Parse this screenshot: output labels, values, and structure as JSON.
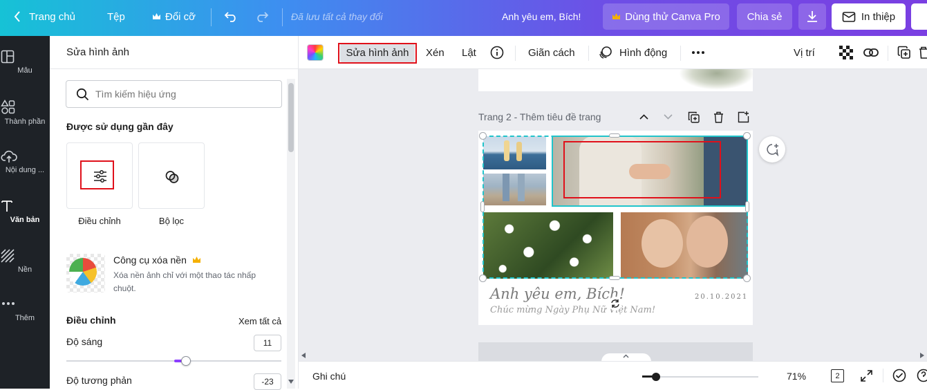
{
  "topbar": {
    "home": "Trang chủ",
    "file": "Tệp",
    "resize": "Đổi cỡ",
    "saved_status": "Đã lưu tất cả thay đổi",
    "design_title": "Anh yêu em, Bích!",
    "try_pro": "Dùng thử Canva Pro",
    "share": "Chia sẻ",
    "print": "In thiệp"
  },
  "rail": {
    "items": [
      {
        "label": "Mẫu",
        "icon": "layout-icon"
      },
      {
        "label": "Thành phần",
        "icon": "shapes-icon"
      },
      {
        "label": "Nội dung ...",
        "icon": "upload-cloud-icon"
      },
      {
        "label": "Văn bản",
        "icon": "text-icon"
      },
      {
        "label": "Nền",
        "icon": "background-pattern-icon"
      },
      {
        "label": "Thêm",
        "icon": "more-dots-icon"
      }
    ]
  },
  "panel": {
    "title": "Sửa hình ảnh",
    "search_placeholder": "Tìm kiếm hiệu ứng",
    "recent_heading": "Được sử dụng gần đây",
    "recent": [
      {
        "label": "Điều chỉnh"
      },
      {
        "label": "Bộ lọc"
      }
    ],
    "bg_remover": {
      "title": "Công cụ xóa nền",
      "desc": "Xóa nền ảnh chỉ với một thao tác nhấp chuột."
    },
    "adjust": {
      "heading": "Điều chỉnh",
      "see_all": "Xem tất cả",
      "sliders": [
        {
          "label": "Độ sáng",
          "value": "11",
          "fraction": 0.555
        },
        {
          "label": "Độ tương phản",
          "value": "-23",
          "fraction": 0.385
        }
      ]
    }
  },
  "toolbar": {
    "edit_image": "Sửa hình ảnh",
    "crop": "Xén",
    "flip": "Lật",
    "spacing": "Giãn cách",
    "animate": "Hình động",
    "position": "Vị trí"
  },
  "page2": {
    "label": "Trang 2 - Thêm tiêu đề trang",
    "card_title": "Anh yêu em, Bích!",
    "card_subtitle": "Chúc mừng Ngày Phụ Nữ Việt Nam!",
    "card_date": "20.10.2021"
  },
  "bottombar": {
    "notes": "Ghi chú",
    "zoom": "71%",
    "zoom_fraction": 0.12,
    "page_count": "2"
  },
  "colors": {
    "highlight_red": "#e0101a",
    "selection_cyan": "#20c4cb",
    "pro_crown": "#f5b000"
  }
}
